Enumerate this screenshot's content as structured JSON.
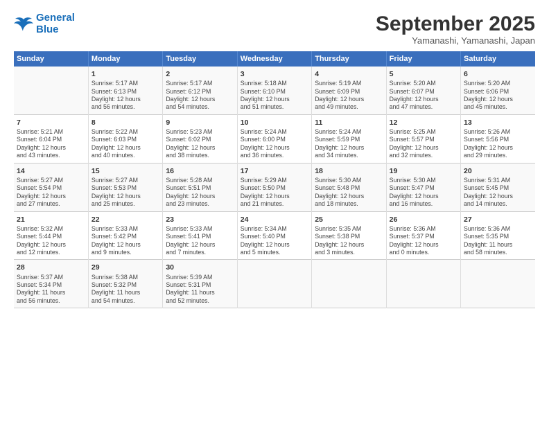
{
  "logo": {
    "line1": "General",
    "line2": "Blue"
  },
  "title": "September 2025",
  "subtitle": "Yamanashi, Yamanashi, Japan",
  "days_header": [
    "Sunday",
    "Monday",
    "Tuesday",
    "Wednesday",
    "Thursday",
    "Friday",
    "Saturday"
  ],
  "weeks": [
    [
      {
        "day": "",
        "info": ""
      },
      {
        "day": "1",
        "info": "Sunrise: 5:17 AM\nSunset: 6:13 PM\nDaylight: 12 hours\nand 56 minutes."
      },
      {
        "day": "2",
        "info": "Sunrise: 5:17 AM\nSunset: 6:12 PM\nDaylight: 12 hours\nand 54 minutes."
      },
      {
        "day": "3",
        "info": "Sunrise: 5:18 AM\nSunset: 6:10 PM\nDaylight: 12 hours\nand 51 minutes."
      },
      {
        "day": "4",
        "info": "Sunrise: 5:19 AM\nSunset: 6:09 PM\nDaylight: 12 hours\nand 49 minutes."
      },
      {
        "day": "5",
        "info": "Sunrise: 5:20 AM\nSunset: 6:07 PM\nDaylight: 12 hours\nand 47 minutes."
      },
      {
        "day": "6",
        "info": "Sunrise: 5:20 AM\nSunset: 6:06 PM\nDaylight: 12 hours\nand 45 minutes."
      }
    ],
    [
      {
        "day": "7",
        "info": "Sunrise: 5:21 AM\nSunset: 6:04 PM\nDaylight: 12 hours\nand 43 minutes."
      },
      {
        "day": "8",
        "info": "Sunrise: 5:22 AM\nSunset: 6:03 PM\nDaylight: 12 hours\nand 40 minutes."
      },
      {
        "day": "9",
        "info": "Sunrise: 5:23 AM\nSunset: 6:02 PM\nDaylight: 12 hours\nand 38 minutes."
      },
      {
        "day": "10",
        "info": "Sunrise: 5:24 AM\nSunset: 6:00 PM\nDaylight: 12 hours\nand 36 minutes."
      },
      {
        "day": "11",
        "info": "Sunrise: 5:24 AM\nSunset: 5:59 PM\nDaylight: 12 hours\nand 34 minutes."
      },
      {
        "day": "12",
        "info": "Sunrise: 5:25 AM\nSunset: 5:57 PM\nDaylight: 12 hours\nand 32 minutes."
      },
      {
        "day": "13",
        "info": "Sunrise: 5:26 AM\nSunset: 5:56 PM\nDaylight: 12 hours\nand 29 minutes."
      }
    ],
    [
      {
        "day": "14",
        "info": "Sunrise: 5:27 AM\nSunset: 5:54 PM\nDaylight: 12 hours\nand 27 minutes."
      },
      {
        "day": "15",
        "info": "Sunrise: 5:27 AM\nSunset: 5:53 PM\nDaylight: 12 hours\nand 25 minutes."
      },
      {
        "day": "16",
        "info": "Sunrise: 5:28 AM\nSunset: 5:51 PM\nDaylight: 12 hours\nand 23 minutes."
      },
      {
        "day": "17",
        "info": "Sunrise: 5:29 AM\nSunset: 5:50 PM\nDaylight: 12 hours\nand 21 minutes."
      },
      {
        "day": "18",
        "info": "Sunrise: 5:30 AM\nSunset: 5:48 PM\nDaylight: 12 hours\nand 18 minutes."
      },
      {
        "day": "19",
        "info": "Sunrise: 5:30 AM\nSunset: 5:47 PM\nDaylight: 12 hours\nand 16 minutes."
      },
      {
        "day": "20",
        "info": "Sunrise: 5:31 AM\nSunset: 5:45 PM\nDaylight: 12 hours\nand 14 minutes."
      }
    ],
    [
      {
        "day": "21",
        "info": "Sunrise: 5:32 AM\nSunset: 5:44 PM\nDaylight: 12 hours\nand 12 minutes."
      },
      {
        "day": "22",
        "info": "Sunrise: 5:33 AM\nSunset: 5:42 PM\nDaylight: 12 hours\nand 9 minutes."
      },
      {
        "day": "23",
        "info": "Sunrise: 5:33 AM\nSunset: 5:41 PM\nDaylight: 12 hours\nand 7 minutes."
      },
      {
        "day": "24",
        "info": "Sunrise: 5:34 AM\nSunset: 5:40 PM\nDaylight: 12 hours\nand 5 minutes."
      },
      {
        "day": "25",
        "info": "Sunrise: 5:35 AM\nSunset: 5:38 PM\nDaylight: 12 hours\nand 3 minutes."
      },
      {
        "day": "26",
        "info": "Sunrise: 5:36 AM\nSunset: 5:37 PM\nDaylight: 12 hours\nand 0 minutes."
      },
      {
        "day": "27",
        "info": "Sunrise: 5:36 AM\nSunset: 5:35 PM\nDaylight: 11 hours\nand 58 minutes."
      }
    ],
    [
      {
        "day": "28",
        "info": "Sunrise: 5:37 AM\nSunset: 5:34 PM\nDaylight: 11 hours\nand 56 minutes."
      },
      {
        "day": "29",
        "info": "Sunrise: 5:38 AM\nSunset: 5:32 PM\nDaylight: 11 hours\nand 54 minutes."
      },
      {
        "day": "30",
        "info": "Sunrise: 5:39 AM\nSunset: 5:31 PM\nDaylight: 11 hours\nand 52 minutes."
      },
      {
        "day": "",
        "info": ""
      },
      {
        "day": "",
        "info": ""
      },
      {
        "day": "",
        "info": ""
      },
      {
        "day": "",
        "info": ""
      }
    ]
  ]
}
